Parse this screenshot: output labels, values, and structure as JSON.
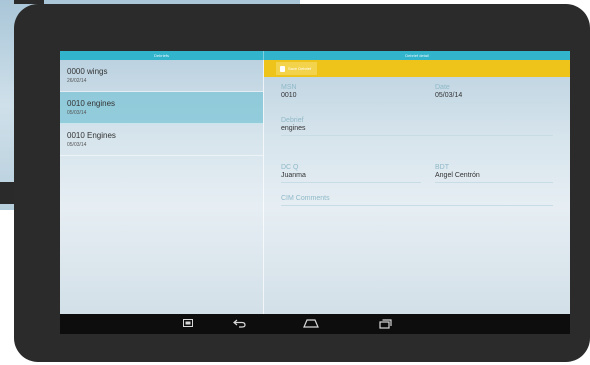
{
  "topbar": {
    "left_title": "Debriefs",
    "right_title": "Debrief detail"
  },
  "debriefs": [
    {
      "name": "0000 wings",
      "date": "26/02/14",
      "selected": false
    },
    {
      "name": "0010 engines",
      "date": "05/03/14",
      "selected": true
    },
    {
      "name": "0010 Engines",
      "date": "05/03/14",
      "selected": false
    }
  ],
  "detail": {
    "save_label": "Save Debrief",
    "msn_label": "MSN",
    "msn_value": "0010",
    "date_label": "Date",
    "date_value": "05/03/14",
    "debrief_label": "Debrief",
    "debrief_value": "engines",
    "dcq_label": "DC Q",
    "dcq_value": "Juanma",
    "bdt_label": "BDT",
    "bdt_value": "Angel Centrón",
    "cim_label": "CIM Comments"
  },
  "navbar": {
    "icons": [
      "screenshot-icon",
      "back-icon",
      "home-icon",
      "recent-apps-icon"
    ]
  },
  "colors": {
    "accent": "#32b4cc",
    "action_bar": "#eec41a",
    "selected_row": "#7dc4d6"
  }
}
